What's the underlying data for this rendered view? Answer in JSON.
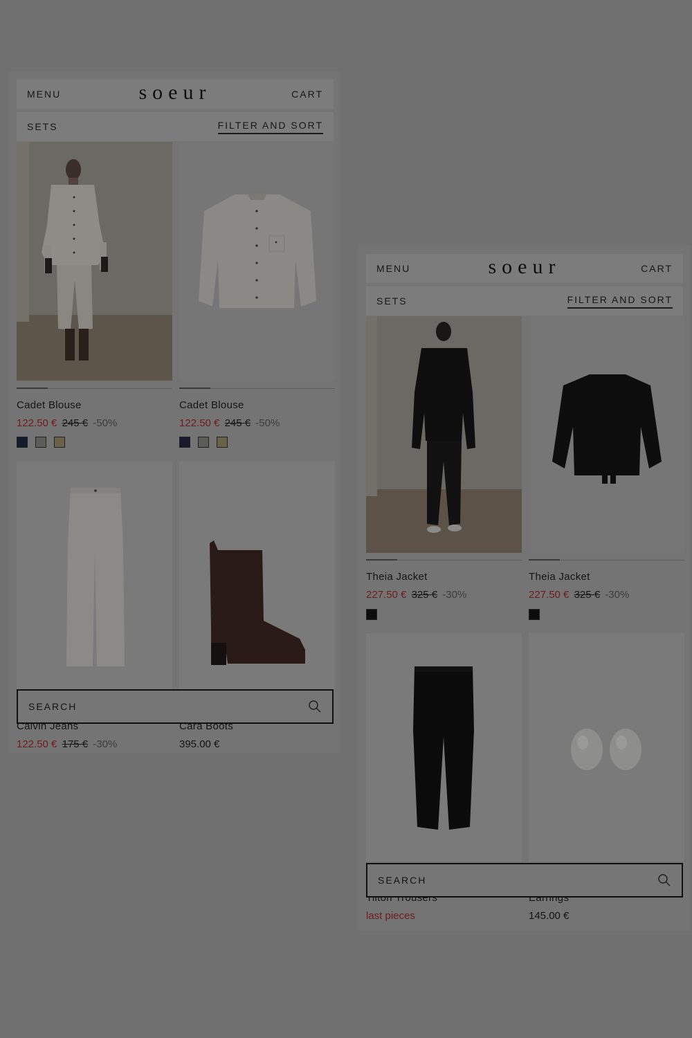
{
  "screens": [
    {
      "header": {
        "menu": "MENU",
        "logo": "soeur",
        "cart": "CART"
      },
      "subbar": {
        "category": "SETS",
        "filter": "FILTER AND SORT"
      },
      "products": [
        {
          "name": "Cadet Blouse",
          "price": "122.50 €",
          "old_price": "245 €",
          "discount": "-50%",
          "swatches": [
            "#161a2a",
            "#5d5d58",
            "#6b6048"
          ]
        },
        {
          "name": "Cadet Blouse",
          "price": "122.50 €",
          "old_price": "245 €",
          "discount": "-50%",
          "swatches": [
            "#161a2a",
            "#5d5d58",
            "#6b6048"
          ]
        },
        {
          "name": "Calvin Jeans",
          "price": "122.50 €",
          "old_price": "175 €",
          "discount": "-30%"
        },
        {
          "name": "Cara Boots",
          "price": "395.00 €"
        }
      ],
      "search": {
        "label": "SEARCH",
        "icon": "search-icon"
      }
    },
    {
      "header": {
        "menu": "MENU",
        "logo": "soeur",
        "cart": "CART"
      },
      "subbar": {
        "category": "SETS",
        "filter": "FILTER AND SORT"
      },
      "products": [
        {
          "name": "Theia Jacket",
          "price": "227.50 €",
          "old_price": "325 €",
          "discount": "-30%",
          "swatches": [
            "#0c0c0c"
          ]
        },
        {
          "name": "Theia Jacket",
          "price": "227.50 €",
          "old_price": "325 €",
          "discount": "-30%",
          "swatches": [
            "#0c0c0c"
          ]
        },
        {
          "name": "Tilton Trousers",
          "status": "last pieces"
        },
        {
          "name": "Earrings",
          "price": "145.00 €"
        }
      ],
      "search": {
        "label": "SEARCH",
        "icon": "search-icon"
      }
    }
  ]
}
